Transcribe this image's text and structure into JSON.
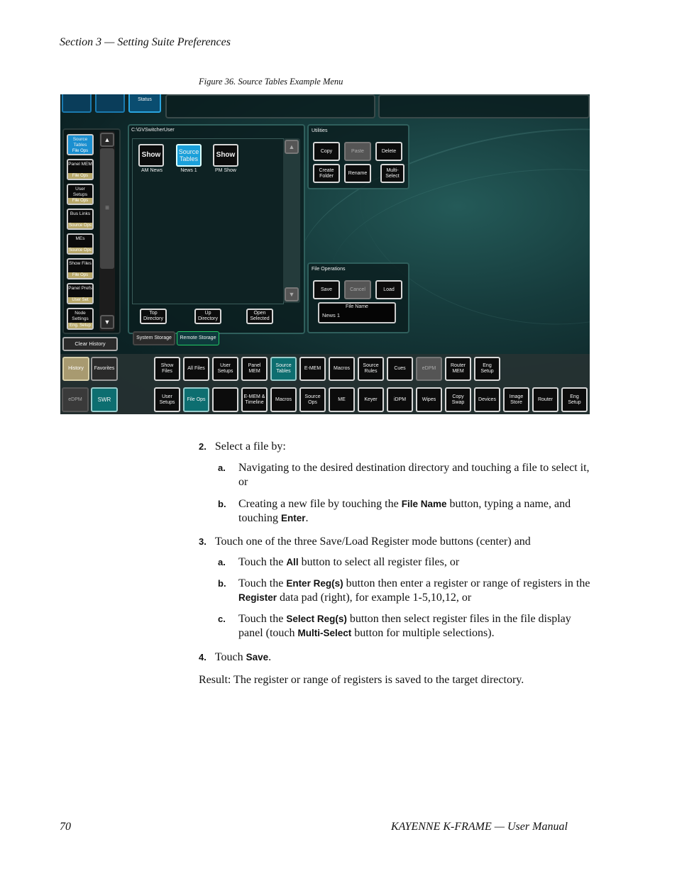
{
  "page": {
    "section_header": "Section 3 — Setting Suite Preferences",
    "figure_caption": "Figure 36.  Source Tables Example Menu",
    "footer_page": "70",
    "footer_title": "KAYENNE K-FRAME  —  User Manual"
  },
  "screen": {
    "top_tabs": [
      "",
      "",
      "Status"
    ],
    "path": "C:\\GVSwitcherUser",
    "files": [
      {
        "icon": "Show",
        "label": "AM News"
      },
      {
        "icon": "Source Tables",
        "label": "News 1"
      },
      {
        "icon": "Show",
        "label": "PM Show"
      }
    ],
    "sidebar": [
      {
        "label": "Source Tables",
        "sub": "File Ops"
      },
      {
        "label": "Panel MEM",
        "sub": "File Ops"
      },
      {
        "label": "User Setups",
        "sub": "File Ops"
      },
      {
        "label": "Bus Links",
        "sub": "Source Ops"
      },
      {
        "label": "MEs",
        "sub": "Source Ops"
      },
      {
        "label": "Show Files",
        "sub": "File Ops"
      },
      {
        "label": "Panel Prefs",
        "sub": "User Set"
      },
      {
        "label": "Node Settings",
        "sub": "Eng. Setup"
      }
    ],
    "clear_history": "Clear History",
    "nav_buttons": [
      "Top Directory",
      "Up Directory",
      "Open Selected"
    ],
    "storage_tabs": [
      "System Storage",
      "Remote Storage"
    ],
    "utilities": {
      "title": "Utilities",
      "buttons": [
        "Copy",
        "Paste",
        "Delete",
        "Create Folder",
        "Rename",
        "Multi-Select"
      ]
    },
    "file_operations": {
      "title": "File Operations",
      "buttons": [
        "Save",
        "Cancel",
        "Load"
      ],
      "file_name_label": "File Name",
      "file_name_value": "News 1"
    },
    "history_tab": "History",
    "favorites_tab": "Favorites",
    "edpm": "eDPM",
    "swr": "SWR",
    "row1": [
      "Show Files",
      "All Files",
      "User Setups",
      "Panel MEM",
      "Source Tables",
      "E-MEM",
      "Macros",
      "Source Rules",
      "Cues",
      "eDPM",
      "Router MEM",
      "Eng Setup"
    ],
    "row2": [
      "User Setups",
      "File Ops",
      "",
      "E-MEM & Timeline",
      "Macros",
      "Source Ops",
      "ME",
      "Keyer",
      "iDPM",
      "Wipes",
      "Copy Swap",
      "Devices",
      "Image Store",
      "Router",
      "Eng Setup"
    ]
  },
  "steps": {
    "s2_num": "2.",
    "s2_text": "Select a file by:",
    "s2a_letter": "a.",
    "s2a_text": "Navigating to the desired destination directory and touching a file to select it, or",
    "s2b_letter": "b.",
    "s2b_t1": "Creating a new file by touching the ",
    "s2b_k1": "File Name",
    "s2b_t2": " button, typing a name, and touching ",
    "s2b_k2": "Enter",
    "s2b_t3": ".",
    "s3_num": "3.",
    "s3_text": "Touch one of the three Save/Load Register mode buttons (center) and",
    "s3a_letter": "a.",
    "s3a_t1": "Touch the ",
    "s3a_k1": "All",
    "s3a_t2": " button to select all register files, or",
    "s3b_letter": "b.",
    "s3b_t1": "Touch the ",
    "s3b_k1": "Enter Reg(s)",
    "s3b_t2": " button then enter a register or range of registers in the ",
    "s3b_k2": "Register",
    "s3b_t3": " data pad (right), for example 1-5,10,12, or",
    "s3c_letter": "c.",
    "s3c_t1": "Touch the ",
    "s3c_k1": "Select Reg(s)",
    "s3c_t2": " button then select register files in the file display panel (touch ",
    "s3c_k2": "Multi-Select",
    "s3c_t3": " button for multiple selections).",
    "s4_num": "4.",
    "s4_t1": "Touch ",
    "s4_k1": "Save",
    "s4_t2": ".",
    "result": "Result: The register or range of registers is saved to the target directory."
  }
}
